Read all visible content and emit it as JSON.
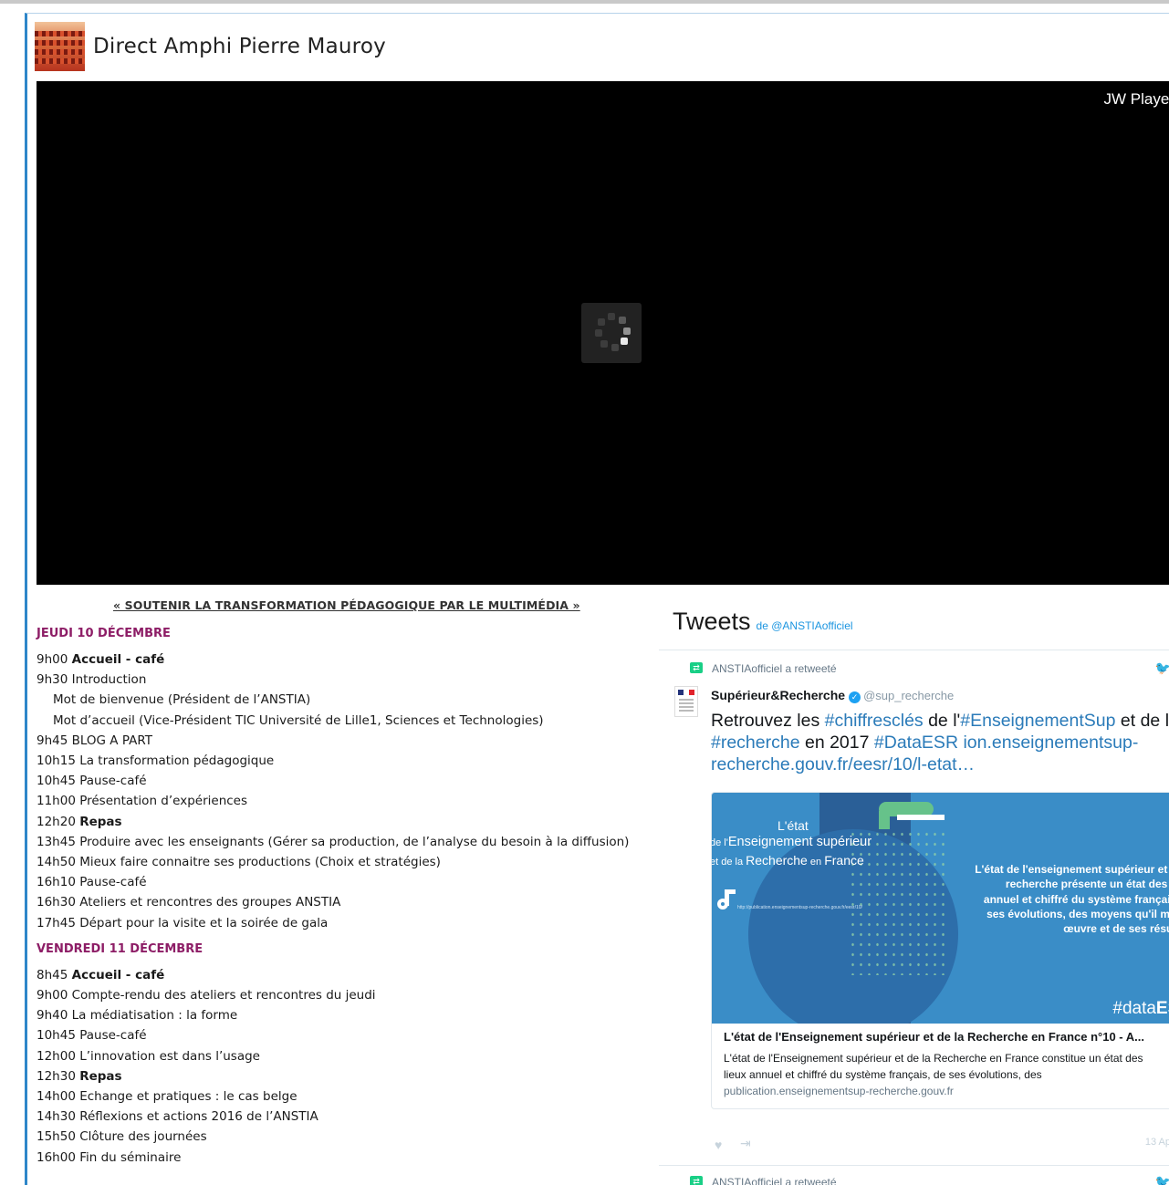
{
  "page": {
    "title": "Direct Amphi Pierre Mauroy"
  },
  "player": {
    "brand": "JW Player"
  },
  "schedule": {
    "banner": "« SOUTENIR LA TRANSFORMATION PÉDAGOGIQUE PAR LE MULTIMÉDIA »",
    "days": [
      {
        "title": "JEUDI 10 DÉCEMBRE",
        "items": [
          {
            "time": "9h00",
            "label": "Accueil - café",
            "bold": true
          },
          {
            "time": "9h30",
            "label": "Introduction",
            "bold": false
          },
          {
            "time": "",
            "label": "Mot de bienvenue (Président de l’ANSTIA)",
            "bold": false,
            "sub": true
          },
          {
            "time": "",
            "label": "Mot d’accueil (Vice-Président TIC Université de Lille1, Sciences et Technologies)",
            "bold": false,
            "sub": true
          },
          {
            "time": "9h45",
            "label": "BLOG A PART",
            "bold": false
          },
          {
            "time": "10h15",
            "label": "La transformation pédagogique",
            "bold": false
          },
          {
            "time": "10h45",
            "label": "Pause-café",
            "bold": false
          },
          {
            "time": "11h00",
            "label": "Présentation d’expériences",
            "bold": false
          },
          {
            "time": "12h20",
            "label": "Repas",
            "bold": true
          },
          {
            "time": "13h45",
            "label": "Produire avec les enseignants (Gérer sa production, de l’analyse du besoin à la diffusion)",
            "bold": false
          },
          {
            "time": "14h50",
            "label": "Mieux faire connaitre ses productions (Choix et stratégies)",
            "bold": false
          },
          {
            "time": "16h10",
            "label": "Pause-café",
            "bold": false
          },
          {
            "time": "16h30",
            "label": "Ateliers et rencontres des groupes ANSTIA",
            "bold": false
          },
          {
            "time": "17h45",
            "label": "Départ pour la visite et la soirée de gala",
            "bold": false
          }
        ]
      },
      {
        "title": "VENDREDI 11 DÉCEMBRE",
        "items": [
          {
            "time": "8h45",
            "label": "Accueil - café",
            "bold": true
          },
          {
            "time": "9h00",
            "label": "Compte-rendu des ateliers et rencontres du jeudi",
            "bold": false
          },
          {
            "time": "9h40",
            "label": "La médiatisation : la forme",
            "bold": false
          },
          {
            "time": "10h45",
            "label": "Pause-café",
            "bold": false
          },
          {
            "time": "12h00",
            "label": "L’innovation est dans l’usage",
            "bold": false
          },
          {
            "time": "12h30",
            "label": "Repas",
            "bold": true
          },
          {
            "time": "14h00",
            "label": "Echange et pratiques : le cas belge",
            "bold": false
          },
          {
            "time": "14h30",
            "label": "Réflexions et actions 2016 de l’ANSTIA",
            "bold": false
          },
          {
            "time": "15h50",
            "label": "Clôture des journées",
            "bold": false
          },
          {
            "time": "16h00",
            "label": "Fin du séminaire",
            "bold": false
          }
        ]
      }
    ]
  },
  "tweets": {
    "heading": "Tweets",
    "by": "de @ANSTIAofficiel",
    "retweet_label": "ANSTIAofficiel a retweeté",
    "author_name": "Supérieur&Recherche",
    "author_handle": "@sup_recherche",
    "text_parts": [
      {
        "t": "Retrouvez les ",
        "link": false
      },
      {
        "t": "#chiffresclés",
        "link": true
      },
      {
        "t": " de l'",
        "link": false
      },
      {
        "t": "#EnseignementSup",
        "link": true
      },
      {
        "t": " et de la ",
        "link": false
      },
      {
        "t": "#recherche",
        "link": true
      },
      {
        "t": " en 2017 ",
        "link": false
      },
      {
        "t": "#DataESR",
        "link": true
      },
      {
        "t": " ",
        "link": false
      },
      {
        "t": "ion.enseignementsup-recherche.gouv.fr/eesr/10/l-etat…",
        "link": true
      }
    ],
    "card": {
      "img_letat": "L'état",
      "img_ens_prefix": "de l'",
      "img_ens": "Enseignement supérieur",
      "img_rech_prefix": "et de la ",
      "img_rech": "Recherche",
      "img_rech_mid": " en ",
      "img_rech_end": "France",
      "img_right": "L'état de l'enseignement supérieur et de la recherche présente un état des lieux annuel et chiffré du système français, de ses évolutions, des moyens qu'il met en œuvre et de ses résultats",
      "img_tag_a": "#data",
      "img_tag_b": "ESR",
      "img_url": "http://publication.enseignementsup-recherche.gouv.fr/eesr/10/",
      "title": "L'état de l'Enseignement supérieur et de la Recherche en France n°10 - A...",
      "description": "L'état de l'Enseignement supérieur et de la Recherche en France constitue un état des lieux annuel et chiffré du système français, de ses évolutions, des",
      "domain": "publication.enseignementsup-recherche.gouv.fr"
    },
    "date": "13 Ap",
    "retweet_label_2": "ANSTIAofficiel a retweeté"
  },
  "colors": {
    "accent_border": "#2e86c9",
    "day_title": "#8d1d66",
    "twitter_link": "#1b95e0",
    "retweet_green": "#19cf86"
  }
}
